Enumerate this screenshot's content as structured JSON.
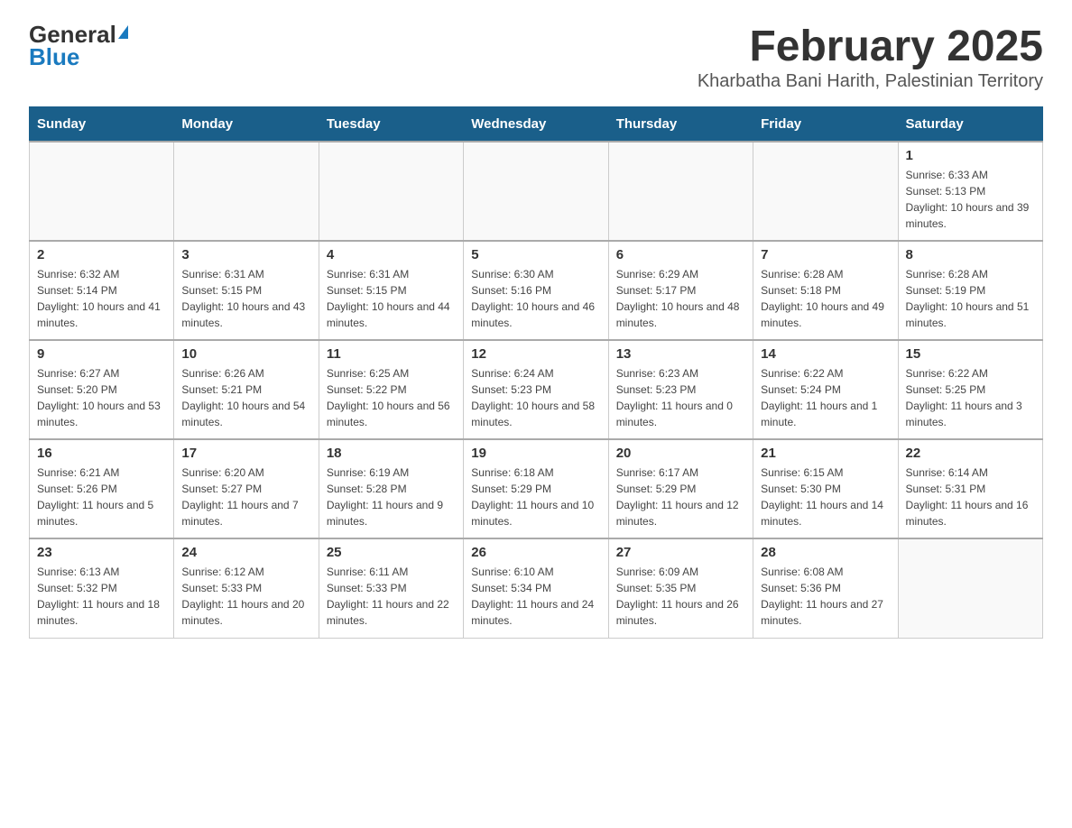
{
  "logo": {
    "text_general": "General",
    "text_blue": "Blue"
  },
  "title": "February 2025",
  "subtitle": "Kharbatha Bani Harith, Palestinian Territory",
  "weekdays": [
    "Sunday",
    "Monday",
    "Tuesday",
    "Wednesday",
    "Thursday",
    "Friday",
    "Saturday"
  ],
  "weeks": [
    [
      {
        "day": "",
        "sunrise": "",
        "sunset": "",
        "daylight": ""
      },
      {
        "day": "",
        "sunrise": "",
        "sunset": "",
        "daylight": ""
      },
      {
        "day": "",
        "sunrise": "",
        "sunset": "",
        "daylight": ""
      },
      {
        "day": "",
        "sunrise": "",
        "sunset": "",
        "daylight": ""
      },
      {
        "day": "",
        "sunrise": "",
        "sunset": "",
        "daylight": ""
      },
      {
        "day": "",
        "sunrise": "",
        "sunset": "",
        "daylight": ""
      },
      {
        "day": "1",
        "sunrise": "Sunrise: 6:33 AM",
        "sunset": "Sunset: 5:13 PM",
        "daylight": "Daylight: 10 hours and 39 minutes."
      }
    ],
    [
      {
        "day": "2",
        "sunrise": "Sunrise: 6:32 AM",
        "sunset": "Sunset: 5:14 PM",
        "daylight": "Daylight: 10 hours and 41 minutes."
      },
      {
        "day": "3",
        "sunrise": "Sunrise: 6:31 AM",
        "sunset": "Sunset: 5:15 PM",
        "daylight": "Daylight: 10 hours and 43 minutes."
      },
      {
        "day": "4",
        "sunrise": "Sunrise: 6:31 AM",
        "sunset": "Sunset: 5:15 PM",
        "daylight": "Daylight: 10 hours and 44 minutes."
      },
      {
        "day": "5",
        "sunrise": "Sunrise: 6:30 AM",
        "sunset": "Sunset: 5:16 PM",
        "daylight": "Daylight: 10 hours and 46 minutes."
      },
      {
        "day": "6",
        "sunrise": "Sunrise: 6:29 AM",
        "sunset": "Sunset: 5:17 PM",
        "daylight": "Daylight: 10 hours and 48 minutes."
      },
      {
        "day": "7",
        "sunrise": "Sunrise: 6:28 AM",
        "sunset": "Sunset: 5:18 PM",
        "daylight": "Daylight: 10 hours and 49 minutes."
      },
      {
        "day": "8",
        "sunrise": "Sunrise: 6:28 AM",
        "sunset": "Sunset: 5:19 PM",
        "daylight": "Daylight: 10 hours and 51 minutes."
      }
    ],
    [
      {
        "day": "9",
        "sunrise": "Sunrise: 6:27 AM",
        "sunset": "Sunset: 5:20 PM",
        "daylight": "Daylight: 10 hours and 53 minutes."
      },
      {
        "day": "10",
        "sunrise": "Sunrise: 6:26 AM",
        "sunset": "Sunset: 5:21 PM",
        "daylight": "Daylight: 10 hours and 54 minutes."
      },
      {
        "day": "11",
        "sunrise": "Sunrise: 6:25 AM",
        "sunset": "Sunset: 5:22 PM",
        "daylight": "Daylight: 10 hours and 56 minutes."
      },
      {
        "day": "12",
        "sunrise": "Sunrise: 6:24 AM",
        "sunset": "Sunset: 5:23 PM",
        "daylight": "Daylight: 10 hours and 58 minutes."
      },
      {
        "day": "13",
        "sunrise": "Sunrise: 6:23 AM",
        "sunset": "Sunset: 5:23 PM",
        "daylight": "Daylight: 11 hours and 0 minutes."
      },
      {
        "day": "14",
        "sunrise": "Sunrise: 6:22 AM",
        "sunset": "Sunset: 5:24 PM",
        "daylight": "Daylight: 11 hours and 1 minute."
      },
      {
        "day": "15",
        "sunrise": "Sunrise: 6:22 AM",
        "sunset": "Sunset: 5:25 PM",
        "daylight": "Daylight: 11 hours and 3 minutes."
      }
    ],
    [
      {
        "day": "16",
        "sunrise": "Sunrise: 6:21 AM",
        "sunset": "Sunset: 5:26 PM",
        "daylight": "Daylight: 11 hours and 5 minutes."
      },
      {
        "day": "17",
        "sunrise": "Sunrise: 6:20 AM",
        "sunset": "Sunset: 5:27 PM",
        "daylight": "Daylight: 11 hours and 7 minutes."
      },
      {
        "day": "18",
        "sunrise": "Sunrise: 6:19 AM",
        "sunset": "Sunset: 5:28 PM",
        "daylight": "Daylight: 11 hours and 9 minutes."
      },
      {
        "day": "19",
        "sunrise": "Sunrise: 6:18 AM",
        "sunset": "Sunset: 5:29 PM",
        "daylight": "Daylight: 11 hours and 10 minutes."
      },
      {
        "day": "20",
        "sunrise": "Sunrise: 6:17 AM",
        "sunset": "Sunset: 5:29 PM",
        "daylight": "Daylight: 11 hours and 12 minutes."
      },
      {
        "day": "21",
        "sunrise": "Sunrise: 6:15 AM",
        "sunset": "Sunset: 5:30 PM",
        "daylight": "Daylight: 11 hours and 14 minutes."
      },
      {
        "day": "22",
        "sunrise": "Sunrise: 6:14 AM",
        "sunset": "Sunset: 5:31 PM",
        "daylight": "Daylight: 11 hours and 16 minutes."
      }
    ],
    [
      {
        "day": "23",
        "sunrise": "Sunrise: 6:13 AM",
        "sunset": "Sunset: 5:32 PM",
        "daylight": "Daylight: 11 hours and 18 minutes."
      },
      {
        "day": "24",
        "sunrise": "Sunrise: 6:12 AM",
        "sunset": "Sunset: 5:33 PM",
        "daylight": "Daylight: 11 hours and 20 minutes."
      },
      {
        "day": "25",
        "sunrise": "Sunrise: 6:11 AM",
        "sunset": "Sunset: 5:33 PM",
        "daylight": "Daylight: 11 hours and 22 minutes."
      },
      {
        "day": "26",
        "sunrise": "Sunrise: 6:10 AM",
        "sunset": "Sunset: 5:34 PM",
        "daylight": "Daylight: 11 hours and 24 minutes."
      },
      {
        "day": "27",
        "sunrise": "Sunrise: 6:09 AM",
        "sunset": "Sunset: 5:35 PM",
        "daylight": "Daylight: 11 hours and 26 minutes."
      },
      {
        "day": "28",
        "sunrise": "Sunrise: 6:08 AM",
        "sunset": "Sunset: 5:36 PM",
        "daylight": "Daylight: 11 hours and 27 minutes."
      },
      {
        "day": "",
        "sunrise": "",
        "sunset": "",
        "daylight": ""
      }
    ]
  ]
}
